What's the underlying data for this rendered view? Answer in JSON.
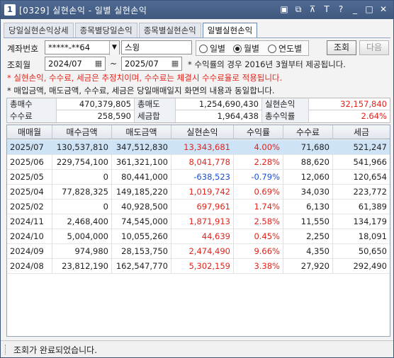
{
  "window": {
    "number": "1",
    "title": "[0329] 실현손익 - 일별 실현손익",
    "icons": [
      "window-icon",
      "copy-icon",
      "pin-icon",
      "text-icon",
      "help-icon",
      "minimize-icon",
      "maximize-icon",
      "close-icon"
    ],
    "icon_glyphs": [
      "▣",
      "⧉",
      "⊼",
      "T",
      "?",
      "_",
      "□",
      "✕"
    ]
  },
  "tabs": [
    {
      "label": "당일실현손익상세",
      "active": false
    },
    {
      "label": "종목별당일손익",
      "active": false
    },
    {
      "label": "종목별실현손익",
      "active": false
    },
    {
      "label": "일별실현손익",
      "active": true
    }
  ],
  "controls": {
    "account_label": "계좌번호",
    "account_value": "*****-**64",
    "account_name": "스윙",
    "radios": [
      {
        "label": "일별",
        "checked": false
      },
      {
        "label": "월별",
        "checked": true
      },
      {
        "label": "연도별",
        "checked": false
      }
    ],
    "query_button": "조회",
    "next_button": "다음",
    "period_label": "조회월",
    "from_month": "2024/07",
    "tilde": "~",
    "to_month": "2025/07",
    "rate_note": "* 수익률의 경우 2016년 3월부터 제공됩니다."
  },
  "notes": {
    "red": "* 실현손익, 수수료, 세금은 추정치이며, 수수료는 체결시 수수료율로 적용됩니다.",
    "black": "* 매입금액, 매도금액, 수수료, 세금은 당일매매일지 화면의 내용과 동일합니다."
  },
  "summary": {
    "total_buy_label": "총매수",
    "total_buy": "470,379,805",
    "total_sell_label": "총매도",
    "total_sell": "1,254,690,430",
    "realized_label": "실현손익",
    "realized": "32,157,840",
    "fee_label": "수수료",
    "fee": "258,590",
    "tax_label": "세금합",
    "tax": "1,964,438",
    "rate_label": "총수익률",
    "rate": "2.64%"
  },
  "table": {
    "headers": [
      "매매월",
      "매수금액",
      "매도금액",
      "실현손익",
      "수익률",
      "수수료",
      "세금"
    ],
    "rows": [
      [
        "2025/07",
        "130,537,810",
        "347,512,830",
        "13,343,681",
        "4.00%",
        "71,680",
        "521,247"
      ],
      [
        "2025/06",
        "229,754,100",
        "361,321,100",
        "8,041,778",
        "2.28%",
        "88,620",
        "541,966"
      ],
      [
        "2025/05",
        "0",
        "80,441,000",
        "-638,523",
        "-0.79%",
        "12,060",
        "120,654"
      ],
      [
        "2025/04",
        "77,828,325",
        "149,185,220",
        "1,019,742",
        "0.69%",
        "34,030",
        "223,772"
      ],
      [
        "2025/02",
        "0",
        "40,928,500",
        "697,961",
        "1.74%",
        "6,130",
        "61,389"
      ],
      [
        "2024/11",
        "2,468,400",
        "74,545,000",
        "1,871,913",
        "2.58%",
        "11,550",
        "134,179"
      ],
      [
        "2024/10",
        "5,004,000",
        "10,055,260",
        "44,639",
        "0.45%",
        "2,250",
        "18,091"
      ],
      [
        "2024/09",
        "974,980",
        "28,153,750",
        "2,474,490",
        "9.66%",
        "4,350",
        "50,650"
      ],
      [
        "2024/08",
        "23,812,190",
        "162,547,770",
        "5,302,159",
        "3.38%",
        "27,920",
        "292,490"
      ]
    ],
    "selected_row": 0
  },
  "status": {
    "text": "조회가 완료되었습니다."
  },
  "colors": {
    "positive": "#e3231b",
    "negative": "#1a4fd6",
    "selected_row": "#cfe3f7"
  }
}
